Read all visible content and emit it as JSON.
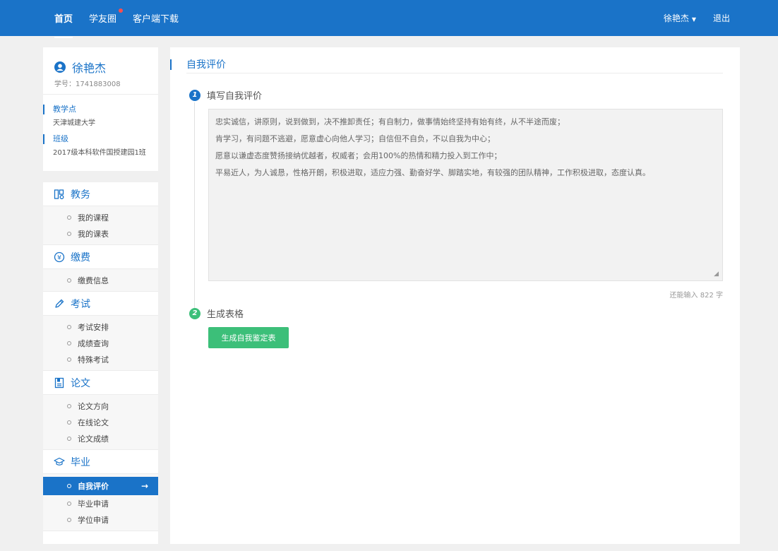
{
  "nav": {
    "links": [
      "首页",
      "学友圈",
      "客户端下载"
    ],
    "user": "徐艳杰",
    "logout": "退出"
  },
  "profile": {
    "name": "徐艳杰",
    "student_id": "学号：1741883008",
    "site_label": "教学点",
    "site_value": "天津城建大学",
    "class_label": "班级",
    "class_value": "2017级本科软件国授建园1班"
  },
  "menu": {
    "jiaowu": {
      "title": "教务",
      "items": [
        "我的课程",
        "我的课表"
      ]
    },
    "jiaofei": {
      "title": "缴费",
      "items": [
        "缴费信息"
      ]
    },
    "kaoshi": {
      "title": "考试",
      "items": [
        "考试安排",
        "成绩查询",
        "特殊考试"
      ]
    },
    "lunwen": {
      "title": "论文",
      "items": [
        "论文方向",
        "在线论文",
        "论文成绩"
      ]
    },
    "biye": {
      "title": "毕业",
      "items": [
        "自我评价",
        "毕业申请",
        "学位申请"
      ]
    },
    "active_arrow": "→"
  },
  "main": {
    "title": "自我评价",
    "step1": {
      "num": "1",
      "title": "填写自我评价"
    },
    "evaluation_lines": [
      "忠实诚信，讲原则，说到做到，决不推卸责任；有自制力，做事情始终坚持有始有终，从不半途而废；",
      "肯学习，有问题不逃避，愿意虚心向他人学习；自信但不自负，不以自我为中心；",
      "愿意以谦虚态度赞扬接纳优越者，权威者；会用100%的热情和精力投入到工作中；",
      "平易近人，为人诚恳，性格开朗，积极进取，适应力强、勤奋好学、脚踏实地，有较强的团队精神，工作积极进取，态度认真。"
    ],
    "char_count": "还能输入 822 字",
    "step2": {
      "num": "2",
      "title": "生成表格"
    },
    "generate_button": "生成自我鉴定表"
  },
  "colors": {
    "primary": "#1a73c8",
    "success": "#3cbf79",
    "alert_dot": "#ff4d4d"
  }
}
